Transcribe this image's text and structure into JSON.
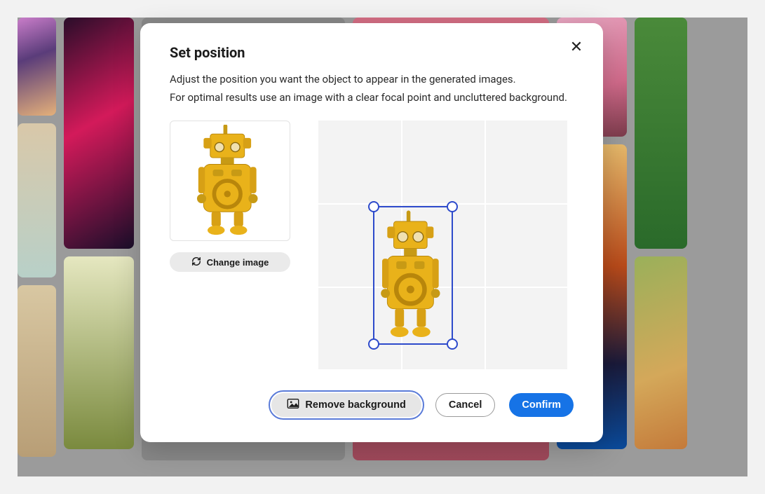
{
  "modal": {
    "title": "Set position",
    "description_line1": "Adjust the position you want the object to appear in the generated images.",
    "description_line2": "For optimal results use an image with a clear focal point and uncluttered background.",
    "change_image_label": "Change image",
    "remove_bg_label": "Remove background",
    "cancel_label": "Cancel",
    "confirm_label": "Confirm",
    "close_glyph": "✕",
    "object_name": "yellow-robot",
    "colors": {
      "primary_button": "#1673e6",
      "selection_outline": "#2d4acb"
    }
  },
  "gallery_hint": "background image grid (obscured by modal)"
}
